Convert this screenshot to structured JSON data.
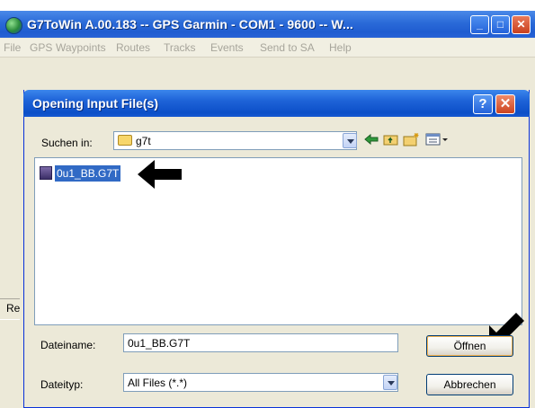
{
  "main_window": {
    "title": "G7ToWin A.00.183 -- GPS Garmin - COM1 - 9600 -- W...",
    "controls": {
      "minimize": "_",
      "maximize": "□",
      "close": "✕"
    },
    "menu": [
      "File",
      "GPS",
      "Waypoints",
      "Routes",
      "Tracks",
      "Events",
      "Send to SA",
      "Help"
    ],
    "status_fragment": "Re"
  },
  "dialog": {
    "title": "Opening Input File(s)",
    "help_label": "?",
    "close_label": "✕",
    "look_in": {
      "label": "Suchen in:",
      "value": "g7t"
    },
    "files": [
      {
        "name": "0u1_BB.G7T",
        "selected": true
      }
    ],
    "filename": {
      "label": "Dateiname:",
      "value": "0u1_BB.G7T"
    },
    "filetype": {
      "label": "Dateityp:",
      "value": "All Files (*.*)"
    },
    "buttons": {
      "open": "Öffnen",
      "cancel": "Abbrechen"
    }
  },
  "icons": {
    "back": "back-arrow-icon",
    "up": "up-folder-icon",
    "new_folder": "new-folder-icon",
    "view": "view-menu-icon",
    "annotation_arrow": "black-arrow-icon"
  },
  "colors": {
    "titlebar_blue": "#1f5cd0",
    "selection_blue": "#316ac5",
    "dialog_face": "#ece9d8"
  }
}
